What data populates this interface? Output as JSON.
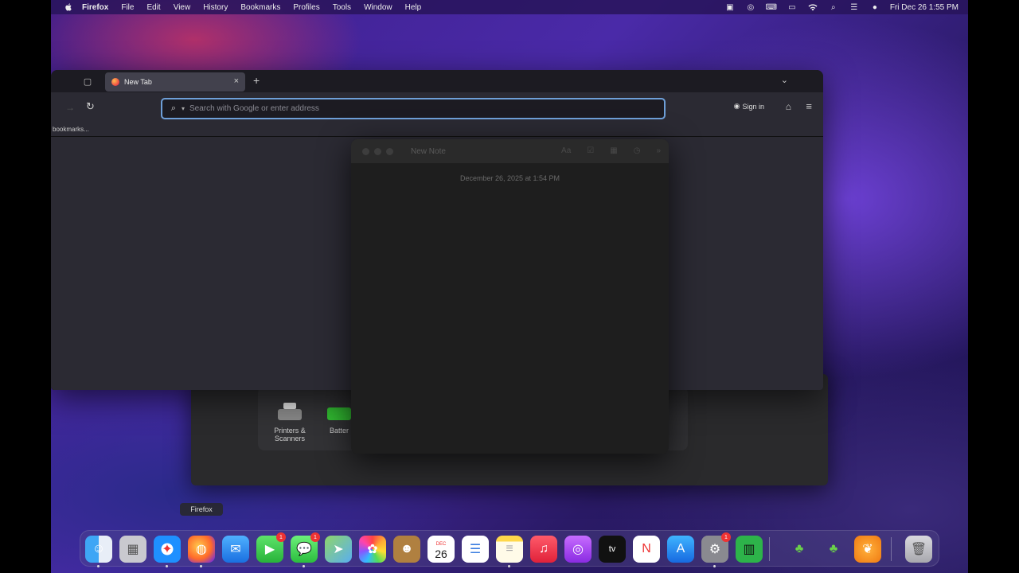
{
  "menubar": {
    "apple": "",
    "items": [
      "Firefox",
      "File",
      "Edit",
      "View",
      "History",
      "Bookmarks",
      "Profiles",
      "Tools",
      "Window",
      "Help"
    ],
    "clock": "Fri Dec 26  1:55 PM"
  },
  "firefox": {
    "tab_title": "New Tab",
    "search_placeholder": "Search with Google or enter address",
    "sign_in": "Sign in",
    "bookmarks_label": "bookmarks..."
  },
  "notes": {
    "title": "New Note",
    "date": "December 26, 2025 at 1:54 PM"
  },
  "settings": {
    "printers_label": "Printers & Scanners",
    "battery_label": "Batter"
  },
  "dock": {
    "tooltip": "Firefox",
    "apps": [
      {
        "name": "finder",
        "icon": "finder-icon"
      },
      {
        "name": "launchpad",
        "icon": "launchpad-icon"
      },
      {
        "name": "safari",
        "icon": "safari-icon"
      },
      {
        "name": "firefox",
        "icon": "firefox-icon"
      },
      {
        "name": "mail",
        "icon": "mail-icon"
      },
      {
        "name": "facetime",
        "icon": "facetime-icon",
        "badge": "1"
      },
      {
        "name": "messages",
        "icon": "messages-icon",
        "badge": "1"
      },
      {
        "name": "maps",
        "icon": "maps-icon"
      },
      {
        "name": "photos",
        "icon": "photos-icon"
      },
      {
        "name": "contacts",
        "icon": "contacts-icon"
      },
      {
        "name": "calendar",
        "icon": "calendar-icon",
        "day": "26",
        "month": "DEC"
      },
      {
        "name": "reminders",
        "icon": "reminders-icon"
      },
      {
        "name": "notes",
        "icon": "notes-icon"
      },
      {
        "name": "music",
        "icon": "music-icon"
      },
      {
        "name": "podcasts",
        "icon": "podcasts-icon"
      },
      {
        "name": "tv",
        "icon": "tv-icon",
        "label": "tv"
      },
      {
        "name": "news",
        "icon": "news-icon"
      },
      {
        "name": "app-store",
        "icon": "app-store-icon"
      },
      {
        "name": "system-settings",
        "icon": "gear-icon",
        "badge": "1"
      },
      {
        "name": "numbers",
        "icon": "numbers-icon"
      },
      {
        "name": "fl-studio-1",
        "icon": "fruit-icon"
      },
      {
        "name": "fl-studio-2",
        "icon": "fruit-icon"
      },
      {
        "name": "fl-studio",
        "icon": "fruit-icon"
      },
      {
        "name": "trash",
        "icon": "trash-icon"
      }
    ]
  }
}
